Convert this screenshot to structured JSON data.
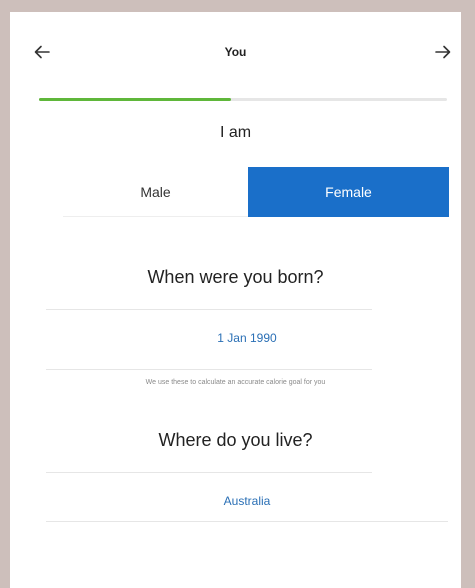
{
  "header": {
    "title": "You",
    "back_icon": "arrow-left-icon",
    "next_icon": "arrow-right-icon"
  },
  "progress": {
    "fraction": 0.47,
    "fill_color": "#5fb73a",
    "track_color": "#e6e6e6"
  },
  "gender": {
    "label": "I am",
    "options": [
      "Male",
      "Female"
    ],
    "selected": "Female",
    "selected_color": "#1a6fc9"
  },
  "birth": {
    "question": "When were you born?",
    "value": "1 Jan 1990",
    "hint": "We use these to calculate an accurate calorie goal for you"
  },
  "location": {
    "question": "Where do you live?",
    "value": "Australia"
  }
}
